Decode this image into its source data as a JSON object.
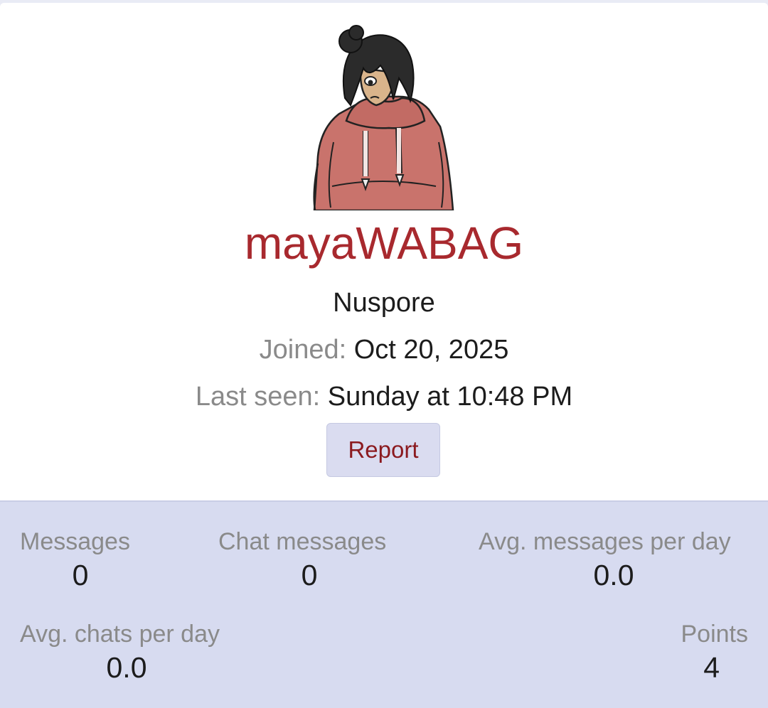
{
  "profile": {
    "avatar_description_icon": "avatar-hoodie-character",
    "username": "mayaWABAG",
    "user_title": "Nuspore",
    "joined_label": "Joined:",
    "joined_value": "Oct 20, 2025",
    "last_seen_label": "Last seen:",
    "last_seen_value": "Sunday at 10:48 PM",
    "report_label": "Report"
  },
  "stats": {
    "messages": {
      "label": "Messages",
      "value": "0"
    },
    "chat_messages": {
      "label": "Chat messages",
      "value": "0"
    },
    "avg_messages": {
      "label": "Avg. messages per day",
      "value": "0.0"
    },
    "avg_chats": {
      "label": "Avg. chats per day",
      "value": "0.0"
    },
    "points": {
      "label": "Points",
      "value": "4"
    }
  },
  "colors": {
    "username": "#a8292e",
    "stats_background": "#d7dbf0",
    "report_button_bg": "#dadcf0",
    "report_text": "#8b1a1f"
  }
}
